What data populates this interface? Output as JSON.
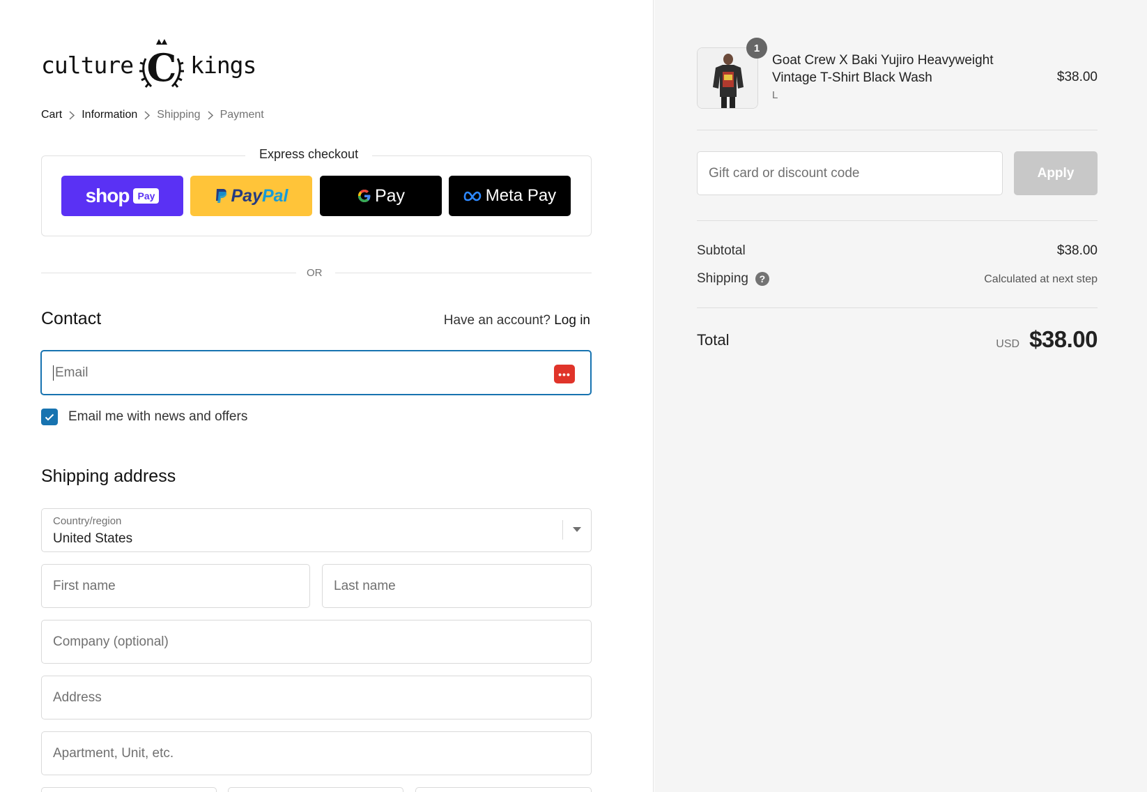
{
  "logo": {
    "left_word": "culture",
    "right_word": "kings",
    "monogram": "C"
  },
  "breadcrumb": [
    "Cart",
    "Information",
    "Shipping",
    "Payment"
  ],
  "express": {
    "title": "Express checkout",
    "shop_pay": {
      "word": "shop",
      "tag": "Pay"
    },
    "paypal": {
      "part1": "Pay",
      "part2": "Pal"
    },
    "google_pay": {
      "text": "Pay"
    },
    "meta_pay": {
      "text": "Meta Pay"
    }
  },
  "divider_text": "OR",
  "contact": {
    "heading": "Contact",
    "account_prompt": "Have an account?",
    "login_link": "Log in",
    "email_placeholder": "Email",
    "newsletter_label": "Email me with news and offers",
    "newsletter_checked": true
  },
  "shipping": {
    "heading": "Shipping address",
    "country_label": "Country/region",
    "country_value": "United States",
    "first_name_placeholder": "First name",
    "last_name_placeholder": "Last name",
    "company_placeholder": "Company (optional)",
    "address_placeholder": "Address",
    "apartment_placeholder": "Apartment, Unit, etc."
  },
  "order": {
    "quantity_badge": "1",
    "product_name": "Goat Crew X Baki Yujiro Heavyweight Vintage T-Shirt Black Wash",
    "variant": "L",
    "price": "$38.00",
    "discount_placeholder": "Gift card or discount code",
    "apply_label": "Apply",
    "subtotal_label": "Subtotal",
    "subtotal_value": "$38.00",
    "shipping_label": "Shipping",
    "shipping_value": "Calculated at next step",
    "total_label": "Total",
    "total_currency": "USD",
    "total_value": "$38.00"
  },
  "colors": {
    "accent": "#1773b0",
    "shop_pay": "#5a31f4",
    "paypal": "#ffc439",
    "right_panel_bg": "#f5f5f5"
  }
}
